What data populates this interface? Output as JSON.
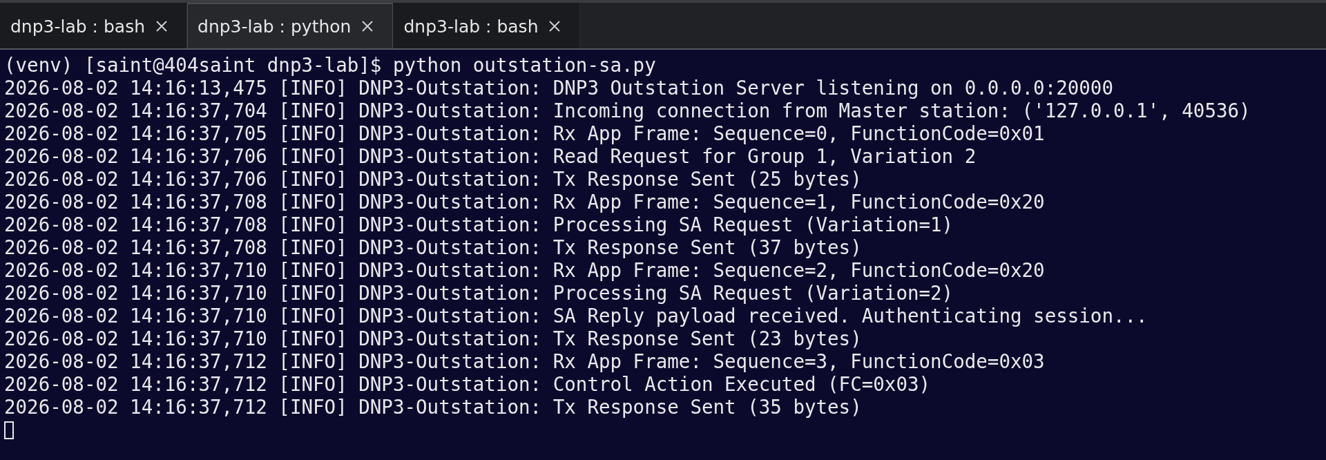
{
  "tabs": [
    {
      "label": "dnp3-lab : bash",
      "selected": false
    },
    {
      "label": "dnp3-lab : python",
      "selected": true
    },
    {
      "label": "dnp3-lab : bash",
      "selected": false
    }
  ],
  "terminal": {
    "prompt": "(venv) [saint@404saint dnp3-lab]$ python outstation-sa.py",
    "lines": [
      "2026-08-02 14:16:13,475 [INFO] DNP3-Outstation: DNP3 Outstation Server listening on 0.0.0.0:20000",
      "2026-08-02 14:16:37,704 [INFO] DNP3-Outstation: Incoming connection from Master station: ('127.0.0.1', 40536)",
      "2026-08-02 14:16:37,705 [INFO] DNP3-Outstation: Rx App Frame: Sequence=0, FunctionCode=0x01",
      "2026-08-02 14:16:37,706 [INFO] DNP3-Outstation: Read Request for Group 1, Variation 2",
      "2026-08-02 14:16:37,706 [INFO] DNP3-Outstation: Tx Response Sent (25 bytes)",
      "2026-08-02 14:16:37,708 [INFO] DNP3-Outstation: Rx App Frame: Sequence=1, FunctionCode=0x20",
      "2026-08-02 14:16:37,708 [INFO] DNP3-Outstation: Processing SA Request (Variation=1)",
      "2026-08-02 14:16:37,708 [INFO] DNP3-Outstation: Tx Response Sent (37 bytes)",
      "2026-08-02 14:16:37,710 [INFO] DNP3-Outstation: Rx App Frame: Sequence=2, FunctionCode=0x20",
      "2026-08-02 14:16:37,710 [INFO] DNP3-Outstation: Processing SA Request (Variation=2)",
      "2026-08-02 14:16:37,710 [INFO] DNP3-Outstation: SA Reply payload received. Authenticating session...",
      "2026-08-02 14:16:37,710 [INFO] DNP3-Outstation: Tx Response Sent (23 bytes)",
      "2026-08-02 14:16:37,712 [INFO] DNP3-Outstation: Rx App Frame: Sequence=3, FunctionCode=0x03",
      "2026-08-02 14:16:37,712 [INFO] DNP3-Outstation: Control Action Executed (FC=0x03)",
      "2026-08-02 14:16:37,712 [INFO] DNP3-Outstation: Tx Response Sent (35 bytes)"
    ]
  }
}
